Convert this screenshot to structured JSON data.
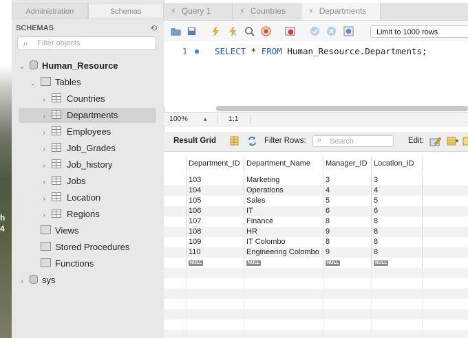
{
  "desktop": {
    "fragment1": "h",
    "fragment2": "4"
  },
  "sidebar": {
    "tabs": [
      {
        "label": "Administration"
      },
      {
        "label": "Schemas"
      }
    ],
    "header": "SCHEMAS",
    "filter_placeholder": "Filter objects",
    "schema_name": "Human_Resource",
    "tables_label": "Tables",
    "tables": [
      "Countries",
      "Departments",
      "Employees",
      "Job_Grades",
      "Job_history",
      "Jobs",
      "Location",
      "Regions"
    ],
    "selected_table": "Departments",
    "other_nodes": [
      "Views",
      "Stored Procedures",
      "Functions"
    ],
    "other_schema": "sys"
  },
  "tabs": [
    {
      "label": "Query 1"
    },
    {
      "label": "Countries"
    },
    {
      "label": "Departments",
      "active": true
    }
  ],
  "toolbar": {
    "limit_label": "Limit to 1000 rows"
  },
  "editor": {
    "line_number": "1",
    "sql_keyword1": "SELECT",
    "sql_star": " * ",
    "sql_keyword2": "FROM",
    "sql_rest": " Human_Resource.Departments;"
  },
  "status": {
    "zoom": "100%",
    "cursor": "1:1"
  },
  "result_bar": {
    "grid_label": "Result Grid",
    "filter_label": "Filter Rows:",
    "search_placeholder": "Search",
    "edit_label": "Edit:"
  },
  "grid": {
    "columns": [
      "Department_ID",
      "Department_Name",
      "Manager_ID",
      "Location_ID"
    ],
    "rows": [
      [
        "103",
        "Marketing",
        "3",
        "3"
      ],
      [
        "104",
        "Operations",
        "4",
        "4"
      ],
      [
        "105",
        "Sales",
        "5",
        "5"
      ],
      [
        "106",
        "IT",
        "6",
        "6"
      ],
      [
        "107",
        "Finance",
        "8",
        "8"
      ],
      [
        "108",
        "HR",
        "9",
        "8"
      ],
      [
        "109",
        "IT Colombo",
        "8",
        "8"
      ],
      [
        "110",
        "Engineering Colombo",
        "9",
        "8"
      ]
    ],
    "null_label": "NULL"
  },
  "colors": {
    "keyword": "#2458c8",
    "selection": "#d2d2d2",
    "accent": "#2f7fd6"
  }
}
